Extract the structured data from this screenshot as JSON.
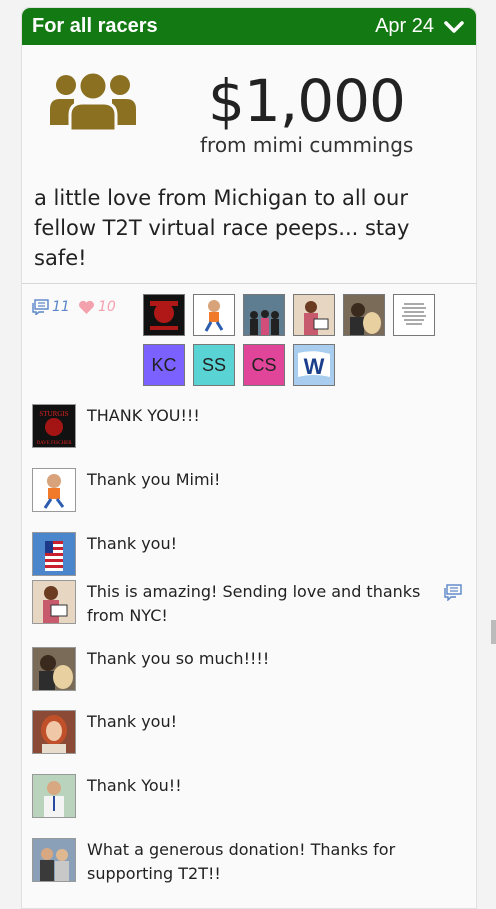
{
  "header": {
    "title": "For all racers",
    "date": "Apr 24"
  },
  "donation": {
    "amount": "$1,000",
    "donor": "from mimi cummings",
    "message": "a little love from Michigan to all our fellow T2T virtual race peeps... stay safe!"
  },
  "stats": {
    "comments": "11",
    "likes": "10"
  },
  "likers": [
    {
      "kind": "logo",
      "label": "STURGIS"
    },
    {
      "kind": "cartoon",
      "label": ""
    },
    {
      "kind": "photo",
      "label": ""
    },
    {
      "kind": "photo",
      "label": ""
    },
    {
      "kind": "photo",
      "label": ""
    },
    {
      "kind": "note",
      "label": ""
    },
    {
      "kind": "initials",
      "label": "KC",
      "color": "#7b61ff"
    },
    {
      "kind": "initials",
      "label": "SS",
      "color": "#5ad3d4"
    },
    {
      "kind": "initials",
      "label": "CS",
      "color": "#e0459a"
    },
    {
      "kind": "flag",
      "label": "W"
    }
  ],
  "comments": [
    {
      "text": "THANK YOU!!!",
      "avatar": "logo"
    },
    {
      "text": "Thank you Mimi!",
      "avatar": "cartoon"
    },
    {
      "text": "Thank you!",
      "avatar": "flag-photo"
    },
    {
      "text": "This is amazing! Sending love and thanks from NYC!",
      "avatar": "photo-sign",
      "has_reply": true
    },
    {
      "text": "Thank you so much!!!!",
      "avatar": "photo-dog"
    },
    {
      "text": "Thank you!",
      "avatar": "photo-woman"
    },
    {
      "text": "Thank You!!",
      "avatar": "photo-man"
    },
    {
      "text": "What a generous donation! Thanks for supporting T2T!!",
      "avatar": "photo-couple"
    }
  ],
  "logo_text": {
    "top": "STURGIS",
    "bottom": "DAVE FISCHER"
  },
  "colors": {
    "header_green": "#137a13",
    "group_icon_olive": "#8a7020",
    "comment_icon_blue": "#5a86c8",
    "heart_pink": "#f3a1ad"
  }
}
